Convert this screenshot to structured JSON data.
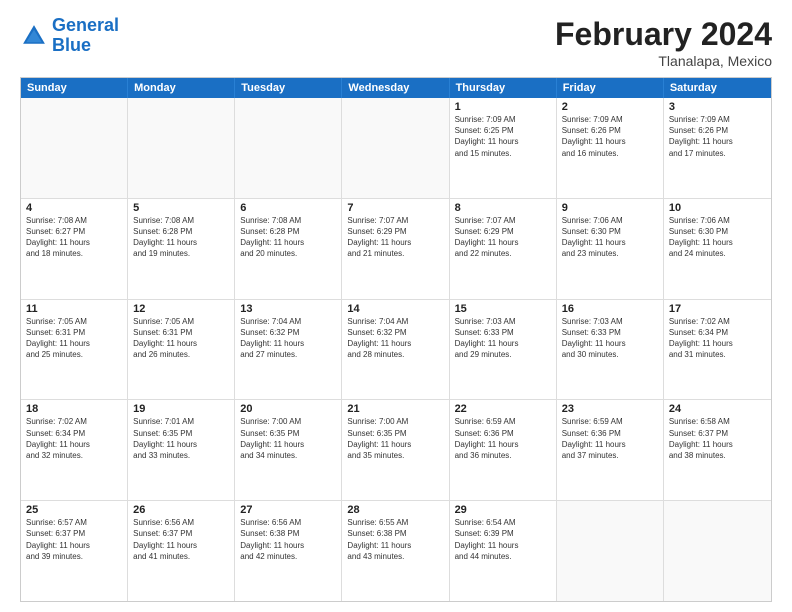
{
  "logo": {
    "line1": "General",
    "line2": "Blue"
  },
  "title": "February 2024",
  "subtitle": "Tlanalapa, Mexico",
  "header_days": [
    "Sunday",
    "Monday",
    "Tuesday",
    "Wednesday",
    "Thursday",
    "Friday",
    "Saturday"
  ],
  "rows": [
    [
      {
        "day": "",
        "info": "",
        "empty": true
      },
      {
        "day": "",
        "info": "",
        "empty": true
      },
      {
        "day": "",
        "info": "",
        "empty": true
      },
      {
        "day": "",
        "info": "",
        "empty": true
      },
      {
        "day": "1",
        "info": "Sunrise: 7:09 AM\nSunset: 6:25 PM\nDaylight: 11 hours\nand 15 minutes."
      },
      {
        "day": "2",
        "info": "Sunrise: 7:09 AM\nSunset: 6:26 PM\nDaylight: 11 hours\nand 16 minutes."
      },
      {
        "day": "3",
        "info": "Sunrise: 7:09 AM\nSunset: 6:26 PM\nDaylight: 11 hours\nand 17 minutes."
      }
    ],
    [
      {
        "day": "4",
        "info": "Sunrise: 7:08 AM\nSunset: 6:27 PM\nDaylight: 11 hours\nand 18 minutes."
      },
      {
        "day": "5",
        "info": "Sunrise: 7:08 AM\nSunset: 6:28 PM\nDaylight: 11 hours\nand 19 minutes."
      },
      {
        "day": "6",
        "info": "Sunrise: 7:08 AM\nSunset: 6:28 PM\nDaylight: 11 hours\nand 20 minutes."
      },
      {
        "day": "7",
        "info": "Sunrise: 7:07 AM\nSunset: 6:29 PM\nDaylight: 11 hours\nand 21 minutes."
      },
      {
        "day": "8",
        "info": "Sunrise: 7:07 AM\nSunset: 6:29 PM\nDaylight: 11 hours\nand 22 minutes."
      },
      {
        "day": "9",
        "info": "Sunrise: 7:06 AM\nSunset: 6:30 PM\nDaylight: 11 hours\nand 23 minutes."
      },
      {
        "day": "10",
        "info": "Sunrise: 7:06 AM\nSunset: 6:30 PM\nDaylight: 11 hours\nand 24 minutes."
      }
    ],
    [
      {
        "day": "11",
        "info": "Sunrise: 7:05 AM\nSunset: 6:31 PM\nDaylight: 11 hours\nand 25 minutes."
      },
      {
        "day": "12",
        "info": "Sunrise: 7:05 AM\nSunset: 6:31 PM\nDaylight: 11 hours\nand 26 minutes."
      },
      {
        "day": "13",
        "info": "Sunrise: 7:04 AM\nSunset: 6:32 PM\nDaylight: 11 hours\nand 27 minutes."
      },
      {
        "day": "14",
        "info": "Sunrise: 7:04 AM\nSunset: 6:32 PM\nDaylight: 11 hours\nand 28 minutes."
      },
      {
        "day": "15",
        "info": "Sunrise: 7:03 AM\nSunset: 6:33 PM\nDaylight: 11 hours\nand 29 minutes."
      },
      {
        "day": "16",
        "info": "Sunrise: 7:03 AM\nSunset: 6:33 PM\nDaylight: 11 hours\nand 30 minutes."
      },
      {
        "day": "17",
        "info": "Sunrise: 7:02 AM\nSunset: 6:34 PM\nDaylight: 11 hours\nand 31 minutes."
      }
    ],
    [
      {
        "day": "18",
        "info": "Sunrise: 7:02 AM\nSunset: 6:34 PM\nDaylight: 11 hours\nand 32 minutes."
      },
      {
        "day": "19",
        "info": "Sunrise: 7:01 AM\nSunset: 6:35 PM\nDaylight: 11 hours\nand 33 minutes."
      },
      {
        "day": "20",
        "info": "Sunrise: 7:00 AM\nSunset: 6:35 PM\nDaylight: 11 hours\nand 34 minutes."
      },
      {
        "day": "21",
        "info": "Sunrise: 7:00 AM\nSunset: 6:35 PM\nDaylight: 11 hours\nand 35 minutes."
      },
      {
        "day": "22",
        "info": "Sunrise: 6:59 AM\nSunset: 6:36 PM\nDaylight: 11 hours\nand 36 minutes."
      },
      {
        "day": "23",
        "info": "Sunrise: 6:59 AM\nSunset: 6:36 PM\nDaylight: 11 hours\nand 37 minutes."
      },
      {
        "day": "24",
        "info": "Sunrise: 6:58 AM\nSunset: 6:37 PM\nDaylight: 11 hours\nand 38 minutes."
      }
    ],
    [
      {
        "day": "25",
        "info": "Sunrise: 6:57 AM\nSunset: 6:37 PM\nDaylight: 11 hours\nand 39 minutes."
      },
      {
        "day": "26",
        "info": "Sunrise: 6:56 AM\nSunset: 6:37 PM\nDaylight: 11 hours\nand 41 minutes."
      },
      {
        "day": "27",
        "info": "Sunrise: 6:56 AM\nSunset: 6:38 PM\nDaylight: 11 hours\nand 42 minutes."
      },
      {
        "day": "28",
        "info": "Sunrise: 6:55 AM\nSunset: 6:38 PM\nDaylight: 11 hours\nand 43 minutes."
      },
      {
        "day": "29",
        "info": "Sunrise: 6:54 AM\nSunset: 6:39 PM\nDaylight: 11 hours\nand 44 minutes."
      },
      {
        "day": "",
        "info": "",
        "empty": true
      },
      {
        "day": "",
        "info": "",
        "empty": true
      }
    ]
  ]
}
